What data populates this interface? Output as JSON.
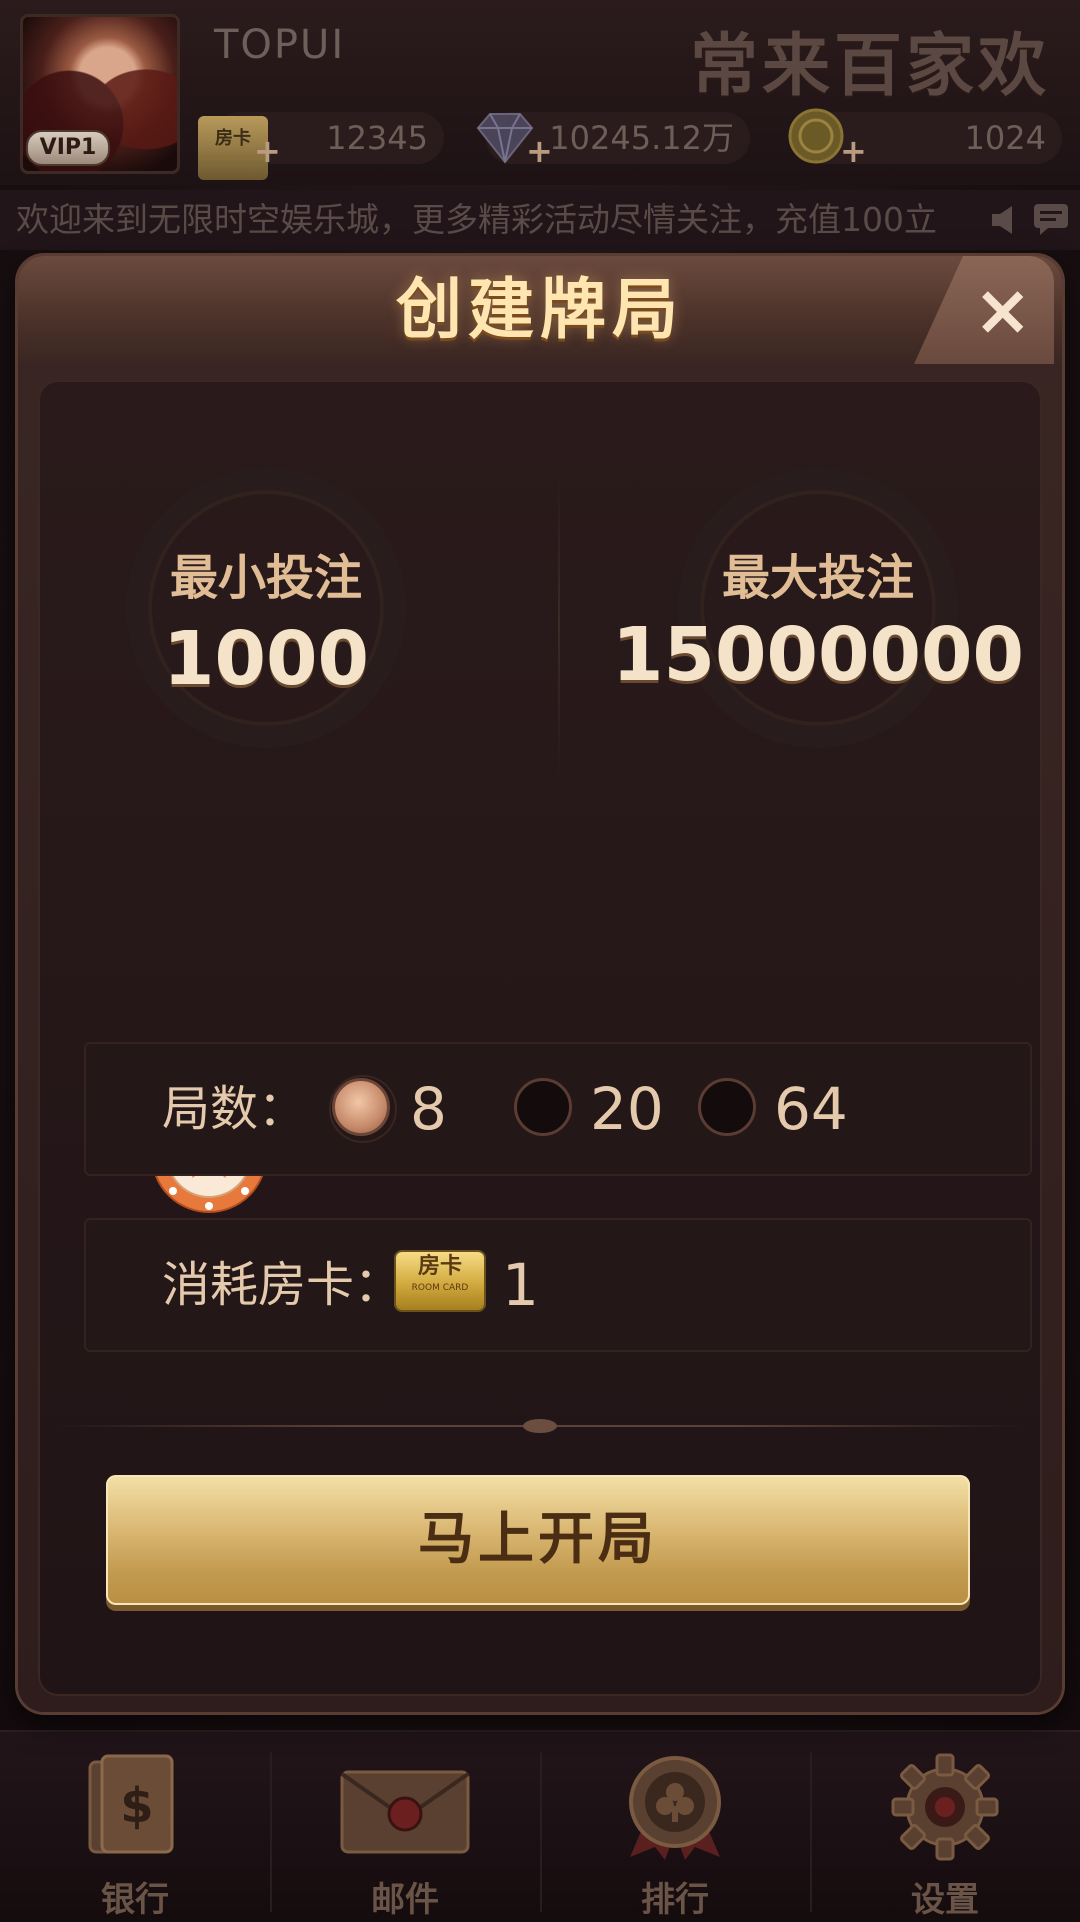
{
  "topbar": {
    "username": "TOPUI",
    "vip": "VIP1",
    "brand": "常来百家欢",
    "room_cards": "12345",
    "room_card_icon_text": "房卡",
    "diamonds": "10245.12万",
    "gold": "1024"
  },
  "marquee": {
    "text": "欢迎来到无限时空娱乐城，更多精彩活动尽情关注，充值100立"
  },
  "dialog": {
    "title": "创建牌局",
    "close_icon": "×",
    "min_bet_label": "最小投注",
    "min_bet_value": "1000",
    "max_bet_label": "最大投注",
    "max_bet_value": "15000000",
    "slider_value": 0,
    "rounds_label": "局数：",
    "rounds_options": [
      "8",
      "20",
      "64"
    ],
    "rounds_selected": "8",
    "cost_label": "消耗房卡：",
    "room_card_text": "房卡",
    "room_card_sub": "ROOM CARD",
    "cost_value": "1",
    "start_button": "马上开局"
  },
  "bottomnav": {
    "items": [
      {
        "label": "银行",
        "icon": "bank-icon"
      },
      {
        "label": "邮件",
        "icon": "mail-icon"
      },
      {
        "label": "排行",
        "icon": "ranking-icon"
      },
      {
        "label": "设置",
        "icon": "settings-icon"
      }
    ]
  },
  "colors": {
    "accent_gold": "#d8b570",
    "title_text": "#ffe6b0",
    "background": "#1a1012"
  }
}
